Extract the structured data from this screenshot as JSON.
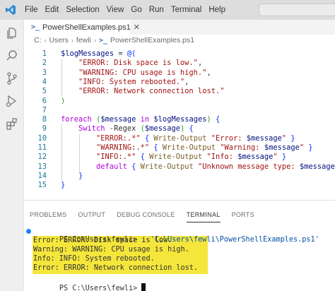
{
  "app": {
    "menu": [
      "File",
      "Edit",
      "Selection",
      "View",
      "Go",
      "Run",
      "Terminal",
      "Help"
    ],
    "accent_color": "#007acc"
  },
  "activity_bar": {
    "icons": [
      "explorer-icon",
      "search-icon",
      "source-control-icon",
      "run-debug-icon",
      "extensions-icon"
    ]
  },
  "editor": {
    "tab_label": "PowerShellExamples.ps1",
    "tab_icon": "powershell-file-icon",
    "breadcrumb": [
      "C:",
      "Users",
      "fewli",
      "PowerShellExamples.ps1"
    ],
    "line_numbers": [
      "1",
      "2",
      "3",
      "4",
      "5",
      "6",
      "7",
      "8",
      "9",
      "10",
      "11",
      "12",
      "13",
      "14",
      "15"
    ],
    "lines": [
      "$logMessages = @(",
      "    \"ERROR: Disk space is low.\",",
      "    \"WARNING: CPU usage is high.\",",
      "    \"INFO: System rebooted.\",",
      "    \"ERROR: Network connection lost.\"",
      ")",
      "",
      "foreach ($message in $logMessages) {",
      "    Switch -Regex ($message) {",
      "        \"ERROR:.*\" { Write-Output \"Error: $message\" }",
      "        \"WARNING:.*\" { Write-Output \"Warning: $message\" }",
      "        \"INFO:.*\" { Write-Output \"Info: $message\" }",
      "        default { Write-Output \"Unknown message type: $message\" }",
      "    }",
      "}"
    ]
  },
  "panel": {
    "tabs": [
      "PROBLEMS",
      "OUTPUT",
      "DEBUG CONSOLE",
      "TERMINAL",
      "PORTS"
    ],
    "active_tab": "TERMINAL",
    "terminal": {
      "command_prompt": "PS C:\\Users\\fewli> ",
      "command_text": ". 'C:\\Users\\fewli\\PowerShellExamples.ps1'",
      "output": [
        "Error: ERROR: Disk space is low.",
        "Warning: WARNING: CPU usage is high.",
        "Info: INFO: System rebooted.",
        "Error: ERROR: Network connection lost."
      ],
      "final_prompt": "PS C:\\Users\\fewli> ",
      "highlight_color": "#f5e63c"
    }
  }
}
